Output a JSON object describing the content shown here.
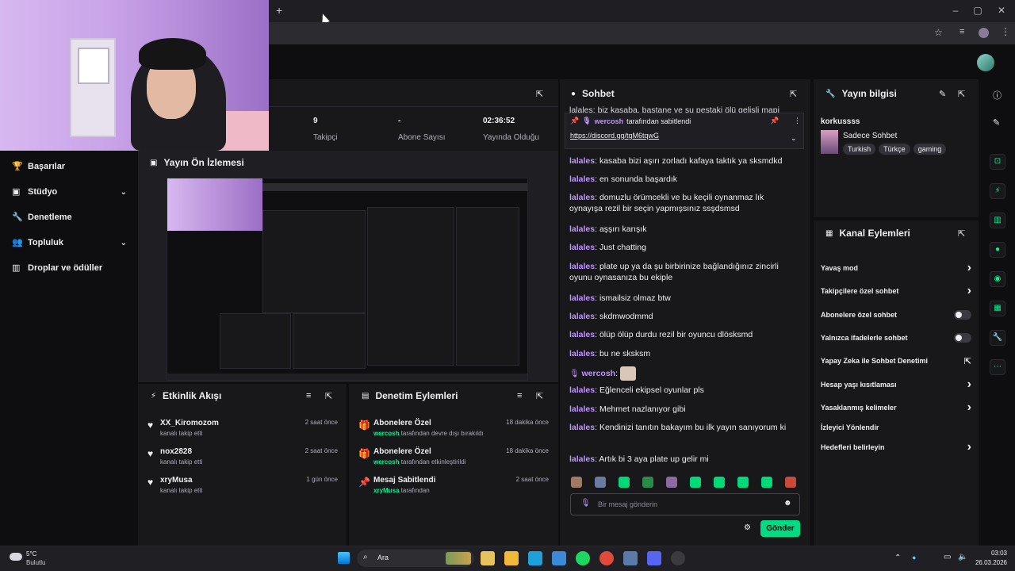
{
  "browser": {
    "new_tab": "+",
    "bookmark_icon": "star-icon",
    "profile_icon": "profile-icon"
  },
  "left_nav": [
    {
      "label": "Başarılar",
      "icon": "trophy-icon",
      "chevron": false
    },
    {
      "label": "Stüdyo",
      "icon": "studio-icon",
      "chevron": true
    },
    {
      "label": "Denetleme",
      "icon": "wrench-icon",
      "chevron": false
    },
    {
      "label": "Topluluk",
      "icon": "community-icon",
      "chevron": true
    },
    {
      "label": "Droplar ve ödüller",
      "icon": "drops-icon",
      "chevron": false
    }
  ],
  "stats": [
    {
      "value": "9",
      "label": "Takipçi"
    },
    {
      "value": "-",
      "label": "Abone Sayısı"
    },
    {
      "value": "02:36:52",
      "label": "Yayında Olduğu"
    }
  ],
  "preview": {
    "title": "Yayın Ön İzlemesi"
  },
  "activity": {
    "title": "Etkinlik Akışı",
    "items": [
      {
        "name": "XX_Kiromozom",
        "sub": "kanalı takip etti",
        "time": "2 saat önce"
      },
      {
        "name": "nox2828",
        "sub": "kanalı takip etti",
        "time": "2 saat önce"
      },
      {
        "name": "xryMusa",
        "sub": "kanalı takip etti",
        "time": "1 gün önce"
      }
    ]
  },
  "mod_actions": {
    "title": "Denetim Eylemleri",
    "items": [
      {
        "name": "Abonelere Özel",
        "user": "wercosh",
        "sub": " tarafından devre dışı bırakıldı",
        "time": "18 dakika önce"
      },
      {
        "name": "Abonelere Özel",
        "user": "wercosh",
        "sub": " tarafından etkinleştirildi",
        "time": "18 dakika önce"
      },
      {
        "name": "Mesaj Sabitlendi",
        "user": "xryMusa",
        "sub": " tarafından",
        "time": "2 saat önce"
      }
    ]
  },
  "chat": {
    "title": "Sohbet",
    "cutoff_line": "lalales: biz kasaba, bastane ve şu pestaki ölü gelişli mapi",
    "pin": {
      "by": "wercosh",
      "by_suffix": " tarafından sabitlendi",
      "link": "https://discord.gg/tgM6tqwG"
    },
    "messages": [
      {
        "user": "lalales",
        "text": "kasaba bizi aşırı zorladı kafaya taktık ya sksmdkd"
      },
      {
        "user": "lalales",
        "text": "en sonunda başardık"
      },
      {
        "user": "lalales",
        "text": "domuzlu örümcekli ve bu keçili oynanmaz lık oynayışa rezil bir seçin yapmışsınız ssşdsmsd"
      },
      {
        "user": "lalales",
        "text": "aşşırı karışık"
      },
      {
        "user": "lalales",
        "text": "Just chatting"
      },
      {
        "user": "lalales",
        "text": "plate up ya da şu birbirinize bağlandığınız zincirli oyunu oynasanıza bu ekiple"
      },
      {
        "user": "lalales",
        "text": "ismailsiz olmaz btw"
      },
      {
        "user": "lalales",
        "text": "skdmwodmmd"
      },
      {
        "user": "lalales",
        "text": "ölüp ölüp durdu rezil bir oyuncu dlösksmd"
      },
      {
        "user": "lalales",
        "text": "bu ne sksksm"
      },
      {
        "user": "wercosh",
        "text": ""
      },
      {
        "user": "lalales",
        "text": "Eğlenceli ekipsel oyunlar pls"
      },
      {
        "user": "lalales",
        "text": "Mehmet nazlanıyor gibi"
      },
      {
        "user": "lalales",
        "text": "Kendinizi tanıtın bakayım bu ilk yayın sanıyorum ki"
      },
      {
        "user": "lalales",
        "text": "Artık bi 3 aya plate up gelir mi"
      }
    ],
    "input_placeholder": "Bir mesaj gönderin",
    "send_label": "Gönder"
  },
  "stream_info": {
    "title": "Yayın bilgisi",
    "channel": "korkussss",
    "stream_title": "Sadece Sohbet",
    "tags": [
      "Turkish",
      "Türkçe",
      "gaming"
    ]
  },
  "channel_actions": {
    "title": "Kanal Eylemleri",
    "items": [
      {
        "label": "Yavaş mod",
        "kind": "chevron"
      },
      {
        "label": "Takipçilere özel sohbet",
        "kind": "chevron"
      },
      {
        "label": "Abonelere özel sohbet",
        "kind": "toggle"
      },
      {
        "label": "Yalnızca ifadelerle sohbet",
        "kind": "toggle"
      },
      {
        "label": "Yapay Zeka ile Sohbet Denetimi",
        "kind": "external"
      },
      {
        "label": "Hesap yaşı kısıtlaması",
        "kind": "chevron"
      },
      {
        "label": "Yasaklanmış kelimeler",
        "kind": "chevron"
      },
      {
        "label": "İzleyici Yönlendir",
        "kind": "none"
      },
      {
        "label": "Hedefleri belirleyin",
        "kind": "chevron"
      }
    ]
  },
  "taskbar": {
    "weather_temp": "5°C",
    "weather_desc": "Bulutlu",
    "search_label": "Ara",
    "time": "03:03",
    "date": "26.03.2026"
  }
}
